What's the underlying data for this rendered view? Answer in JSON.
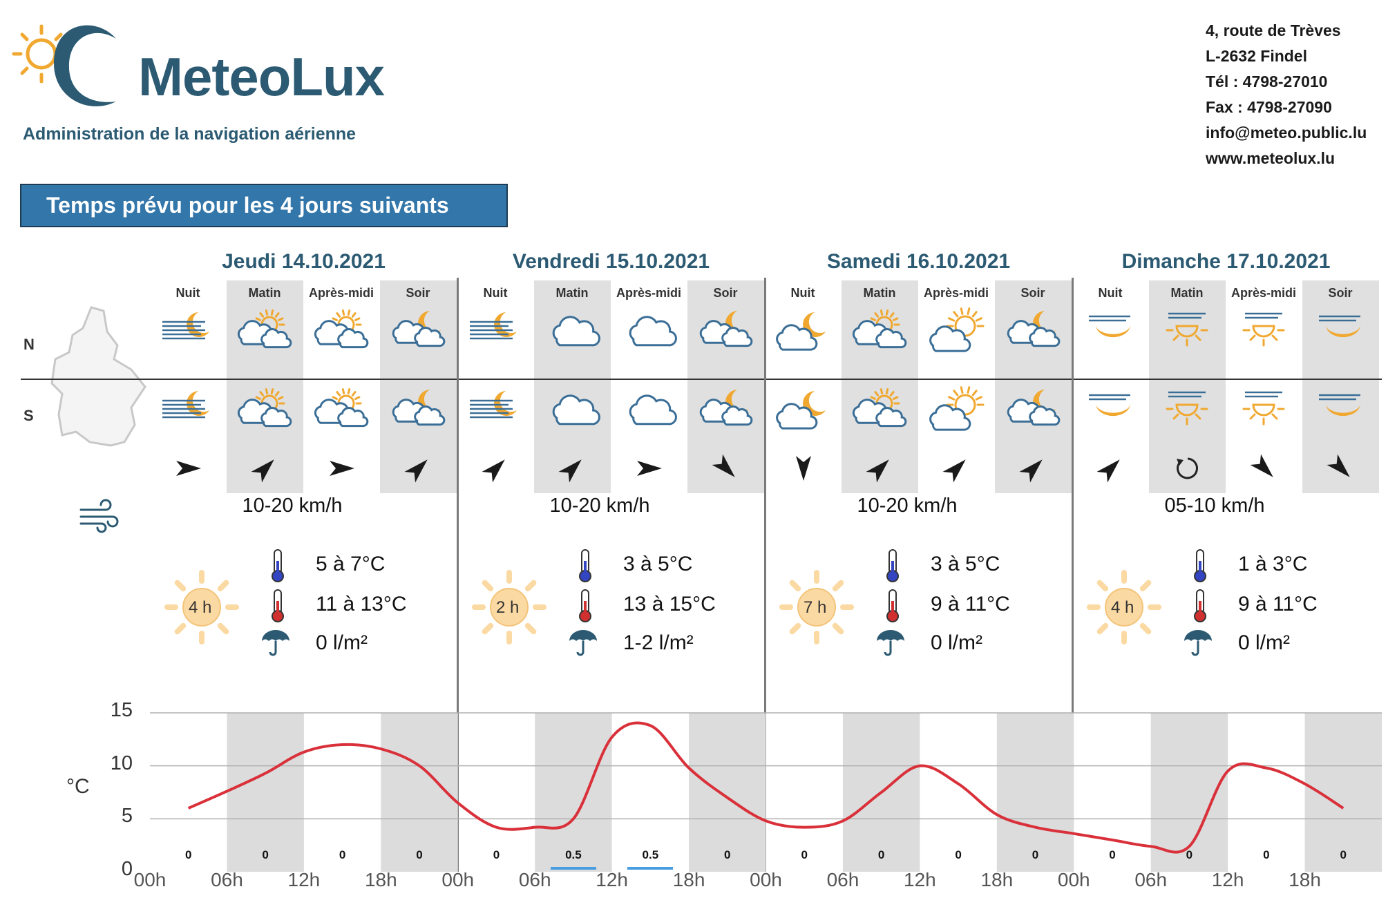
{
  "header": {
    "logo_text": "MeteoLux",
    "subtitle": "Administration de la navigation aérienne",
    "contact": [
      "4, route de Trèves",
      "L-2632 Findel",
      "Tél :  4798-27010",
      "Fax : 4798-27090",
      "info@meteo.public.lu",
      "www.meteolux.lu"
    ]
  },
  "banner": "Temps prévu pour les 4 jours suivants",
  "row_labels": {
    "north": "N",
    "south": "S"
  },
  "periods": [
    "Nuit",
    "Matin",
    "Après-midi",
    "Soir"
  ],
  "days": [
    {
      "title": "Jeudi 14.10.2021",
      "north_icons": [
        "fog-moon",
        "partly-cloudy-sun",
        "partly-cloudy-sun",
        "partly-cloudy-moon"
      ],
      "south_icons": [
        "fog-moon",
        "partly-cloudy-sun",
        "partly-cloudy-sun",
        "partly-cloudy-moon"
      ],
      "wind_dirs": [
        "E",
        "NE",
        "E",
        "NE"
      ],
      "wind_speed": "10-20 km/h",
      "sun_hours": "4 h",
      "temp_min": "5 à 7°C",
      "temp_max": "11 à 13°C",
      "precip_total": "0 l/m²"
    },
    {
      "title": "Vendredi 15.10.2021",
      "north_icons": [
        "fog-moon",
        "cloud",
        "cloud",
        "partly-cloudy-moon"
      ],
      "south_icons": [
        "fog-moon",
        "cloud",
        "cloud",
        "partly-cloudy-moon"
      ],
      "wind_dirs": [
        "NE",
        "NE",
        "E",
        "SE"
      ],
      "wind_speed": "10-20 km/h",
      "sun_hours": "2 h",
      "temp_min": "3 à 5°C",
      "temp_max": "13 à 15°C",
      "precip_total": "1-2 l/m²"
    },
    {
      "title": "Samedi 16.10.2021",
      "north_icons": [
        "cloud-moon",
        "partly-cloudy-sun",
        "cloud-sun",
        "partly-cloudy-moon"
      ],
      "south_icons": [
        "cloud-moon",
        "partly-cloudy-sun",
        "cloud-sun",
        "partly-cloudy-moon"
      ],
      "wind_dirs": [
        "S",
        "NE",
        "NE",
        "NE"
      ],
      "wind_speed": "10-20 km/h",
      "sun_hours": "7 h",
      "temp_min": "3 à 5°C",
      "temp_max": "9 à 11°C",
      "precip_total": "0 l/m²"
    },
    {
      "title": "Dimanche 17.10.2021",
      "north_icons": [
        "haze-moon",
        "haze-sun",
        "haze-sun",
        "haze-moon"
      ],
      "south_icons": [
        "haze-moon",
        "haze-sun",
        "haze-sun",
        "haze-moon"
      ],
      "wind_dirs": [
        "NE",
        "variable",
        "SE",
        "SE"
      ],
      "wind_speed": "05-10 km/h",
      "sun_hours": "4 h",
      "temp_min": "1 à 3°C",
      "temp_max": "9 à 11°C",
      "precip_total": "0 l/m²"
    }
  ],
  "chart_data": {
    "type": "line",
    "ylabel": "°C",
    "ylim": [
      0,
      15
    ],
    "yticks": [
      0,
      5,
      10,
      15
    ],
    "xlim": [
      0,
      96
    ],
    "xtick_labels": [
      "00h",
      "06h",
      "12h",
      "18h",
      "00h",
      "06h",
      "12h",
      "18h",
      "00h",
      "06h",
      "12h",
      "18h",
      "00h",
      "06h",
      "12h",
      "18h"
    ],
    "series": [
      {
        "color": "#d9303a",
        "x": [
          3,
          6,
          9,
          12,
          15,
          18,
          21,
          24,
          27,
          30,
          33,
          36,
          39,
          42,
          45,
          48,
          51,
          54,
          57,
          60,
          63,
          66,
          69,
          72,
          75,
          78,
          81,
          84,
          87,
          90,
          93
        ],
        "y": [
          6,
          7.6,
          9.3,
          11.3,
          12,
          11.6,
          10,
          6.5,
          4.2,
          4.2,
          5,
          12.7,
          13.8,
          9.8,
          7,
          4.8,
          4.2,
          4.8,
          7.5,
          10,
          8.3,
          5.4,
          4.2,
          3.6,
          3,
          2.4,
          2.4,
          9.5,
          9.8,
          8.3,
          6
        ]
      }
    ],
    "precipitation": {
      "x": [
        3,
        9,
        15,
        21,
        27,
        33,
        39,
        45,
        51,
        57,
        63,
        69,
        75,
        81,
        87,
        93
      ],
      "labels": [
        "0",
        "0",
        "0",
        "0",
        "0",
        "0.5",
        "0.5",
        "0",
        "0",
        "0",
        "0",
        "0",
        "0",
        "0",
        "0",
        "0"
      ]
    }
  },
  "colors": {
    "brand": "#2b5a72",
    "banner": "#3276aa",
    "sun": "#f0a830",
    "cloud": "#3b6e96",
    "curve": "#d9303a"
  }
}
